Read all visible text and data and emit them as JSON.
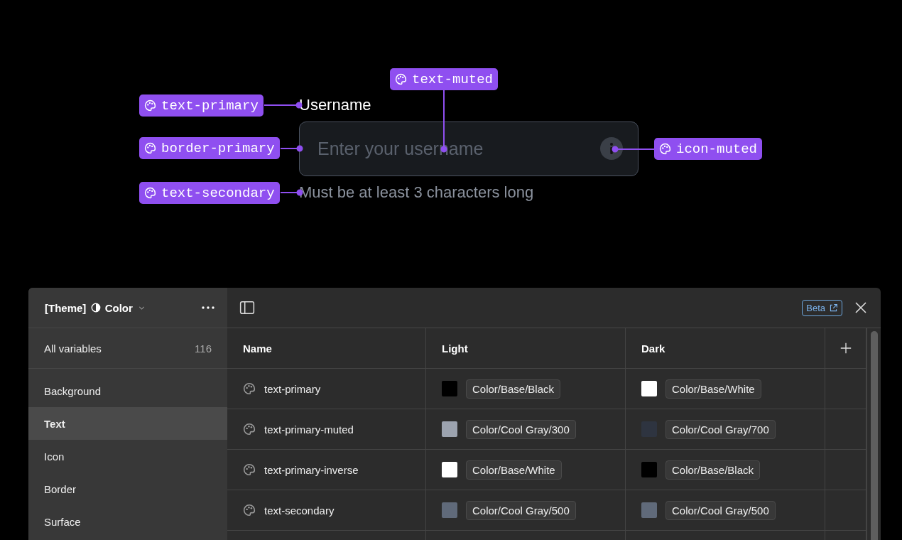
{
  "preview": {
    "label": "Username",
    "placeholder": "Enter your username",
    "helper": "Must be at least 3 characters long"
  },
  "annotations": [
    {
      "label": "text-primary"
    },
    {
      "label": "border-primary"
    },
    {
      "label": "text-secondary"
    },
    {
      "label": "text-muted"
    },
    {
      "label": "icon-muted"
    }
  ],
  "panel": {
    "collection": {
      "prefix": "[Theme]",
      "name": "Color"
    },
    "badge": "Beta",
    "sidebar": {
      "all": {
        "label": "All variables",
        "count": "116"
      },
      "items": [
        {
          "label": "Background",
          "selected": false
        },
        {
          "label": "Text",
          "selected": true
        },
        {
          "label": "Icon",
          "selected": false
        },
        {
          "label": "Border",
          "selected": false
        },
        {
          "label": "Surface",
          "selected": false
        }
      ]
    },
    "table": {
      "columns": [
        "Name",
        "Light",
        "Dark"
      ],
      "rows": [
        {
          "name": "text-primary",
          "light": {
            "color": "#000000",
            "value": "Color/Base/Black"
          },
          "dark": {
            "color": "#ffffff",
            "value": "Color/Base/White"
          }
        },
        {
          "name": "text-primary-muted",
          "light": {
            "color": "#9ca3af",
            "value": "Color/Cool Gray/300"
          },
          "dark": {
            "color": "#2e3440",
            "value": "Color/Cool Gray/700"
          }
        },
        {
          "name": "text-primary-inverse",
          "light": {
            "color": "#ffffff",
            "value": "Color/Base/White"
          },
          "dark": {
            "color": "#000000",
            "value": "Color/Base/Black"
          }
        },
        {
          "name": "text-secondary",
          "light": {
            "color": "#606a7a",
            "value": "Color/Cool Gray/500"
          },
          "dark": {
            "color": "#606a7a",
            "value": "Color/Cool Gray/500"
          }
        }
      ]
    }
  }
}
